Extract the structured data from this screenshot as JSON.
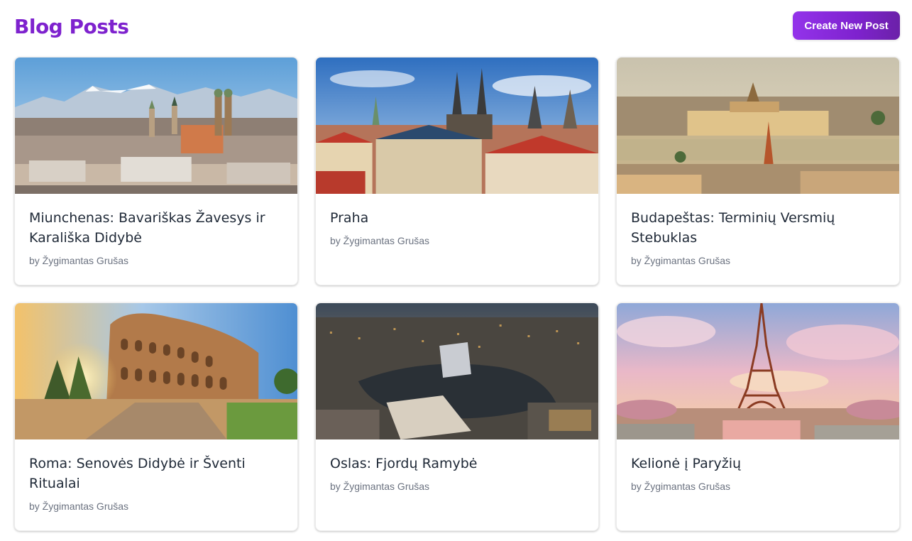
{
  "header": {
    "title": "Blog Posts",
    "create_button_label": "Create New Post"
  },
  "theme": {
    "accent": "#7e22ce",
    "button_gradient": [
      "#9333ea",
      "#6b21a8"
    ]
  },
  "posts": [
    {
      "title": "Miunchenas: Bavariškas Žavesys ir Karališka Didybė",
      "author": "by Žygimantas Grušas",
      "image": "munich-cityscape-with-alps"
    },
    {
      "title": "Praha",
      "author": "by Žygimantas Grušas",
      "image": "prague-old-town-spires"
    },
    {
      "title": "Budapeštas: Terminių Versmių Stebuklas",
      "author": "by Žygimantas Grušas",
      "image": "budapest-parliament-danube"
    },
    {
      "title": "Roma: Senovės Didybė ir Šventi Ritualai",
      "author": "by Žygimantas Grušas",
      "image": "rome-colosseum-sunburst"
    },
    {
      "title": "Oslas: Fjordų Ramybė",
      "author": "by Žygimantas Grušas",
      "image": "oslo-aerial-harbor-dusk"
    },
    {
      "title": "Kelionė į Paryžių",
      "author": "by Žygimantas Grušas",
      "image": "paris-eiffel-tower-pink-sky"
    }
  ]
}
